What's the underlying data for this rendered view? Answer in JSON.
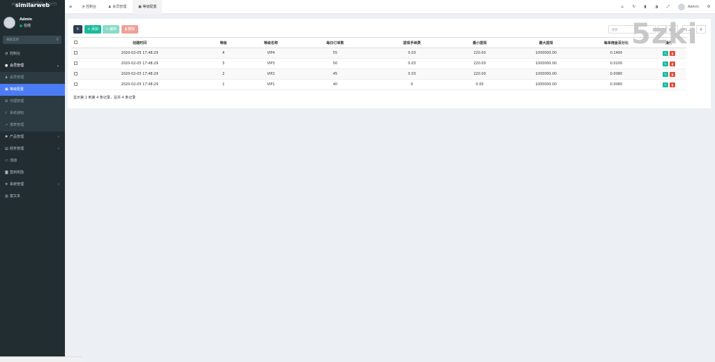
{
  "logo": {
    "text": "similarweb",
    "watermark": "www.ys589.com"
  },
  "user": {
    "name": "Admin",
    "status": "在线"
  },
  "sidebar": {
    "search_placeholder": "搜索菜单",
    "items": [
      {
        "label": "控制台",
        "icon": "dashboard-icon"
      },
      {
        "label": "会员管理",
        "icon": "user-circle-icon",
        "open": true
      },
      {
        "label": "会员管理",
        "icon": "user-icon",
        "sub": true
      },
      {
        "label": "等级配置",
        "icon": "sliders-icon",
        "sub": true,
        "active": true
      },
      {
        "label": "代理管理",
        "icon": "sitemap-icon",
        "sub": true
      },
      {
        "label": "系统通知",
        "icon": "bell-icon",
        "sub": true
      },
      {
        "label": "报表管理",
        "icon": "chart-line-icon",
        "sub": true
      },
      {
        "label": "产品管理",
        "icon": "gear-icon",
        "arrow": true
      },
      {
        "label": "财务管理",
        "icon": "wallet-icon",
        "arrow": true
      },
      {
        "label": "活动",
        "icon": "car-icon"
      },
      {
        "label": "签到奖励",
        "icon": "gift-icon"
      },
      {
        "label": "系统管理",
        "icon": "cogs-icon",
        "arrow": true
      },
      {
        "label": "富文本",
        "icon": "file-icon"
      }
    ]
  },
  "topbar": {
    "menu_icon": "≡",
    "tabs": [
      {
        "label": "控制台",
        "icon": "dashboard-icon"
      },
      {
        "label": "会员管理",
        "icon": "user-icon"
      },
      {
        "label": "等级配置",
        "icon": "sliders-icon",
        "active": true
      }
    ],
    "admin_label": "Admin"
  },
  "toolbar": {
    "add_label": "添加",
    "edit_label": "编辑",
    "delete_label": "删除",
    "search_placeholder": "搜索"
  },
  "table": {
    "columns": [
      "创建时间",
      "等级",
      "等级名称",
      "每日订单数",
      "提现手续费",
      "最小提现",
      "最大提现",
      "每单佣金百分比",
      "操作"
    ],
    "rows": [
      [
        "2020-02-05 17:48:29",
        "4",
        "VIP4",
        "55",
        "0.03",
        "220.00",
        "1000000.00",
        "0.1400"
      ],
      [
        "2020-02-05 17:48:29",
        "3",
        "VIP3",
        "50",
        "0.03",
        "220.00",
        "1000000.00",
        "0.0100"
      ],
      [
        "2020-02-05 17:48:29",
        "2",
        "VIP2",
        "45",
        "0.03",
        "220.00",
        "1000000.00",
        "0.0080"
      ],
      [
        "2020-02-05 17:48:29",
        "1",
        "VIP1",
        "40",
        "0",
        "0.00",
        "1000000.00",
        "0.0060"
      ]
    ],
    "footer": "显示第 1 到第 4 条记录，总共 4 条记录"
  },
  "overlay_watermark": "5zki",
  "colors": {
    "sidebar": "#222d32",
    "active": "#4b7cf3",
    "add": "#18bc9c",
    "delete": "#e74c3c",
    "refresh": "#2c3e50"
  }
}
